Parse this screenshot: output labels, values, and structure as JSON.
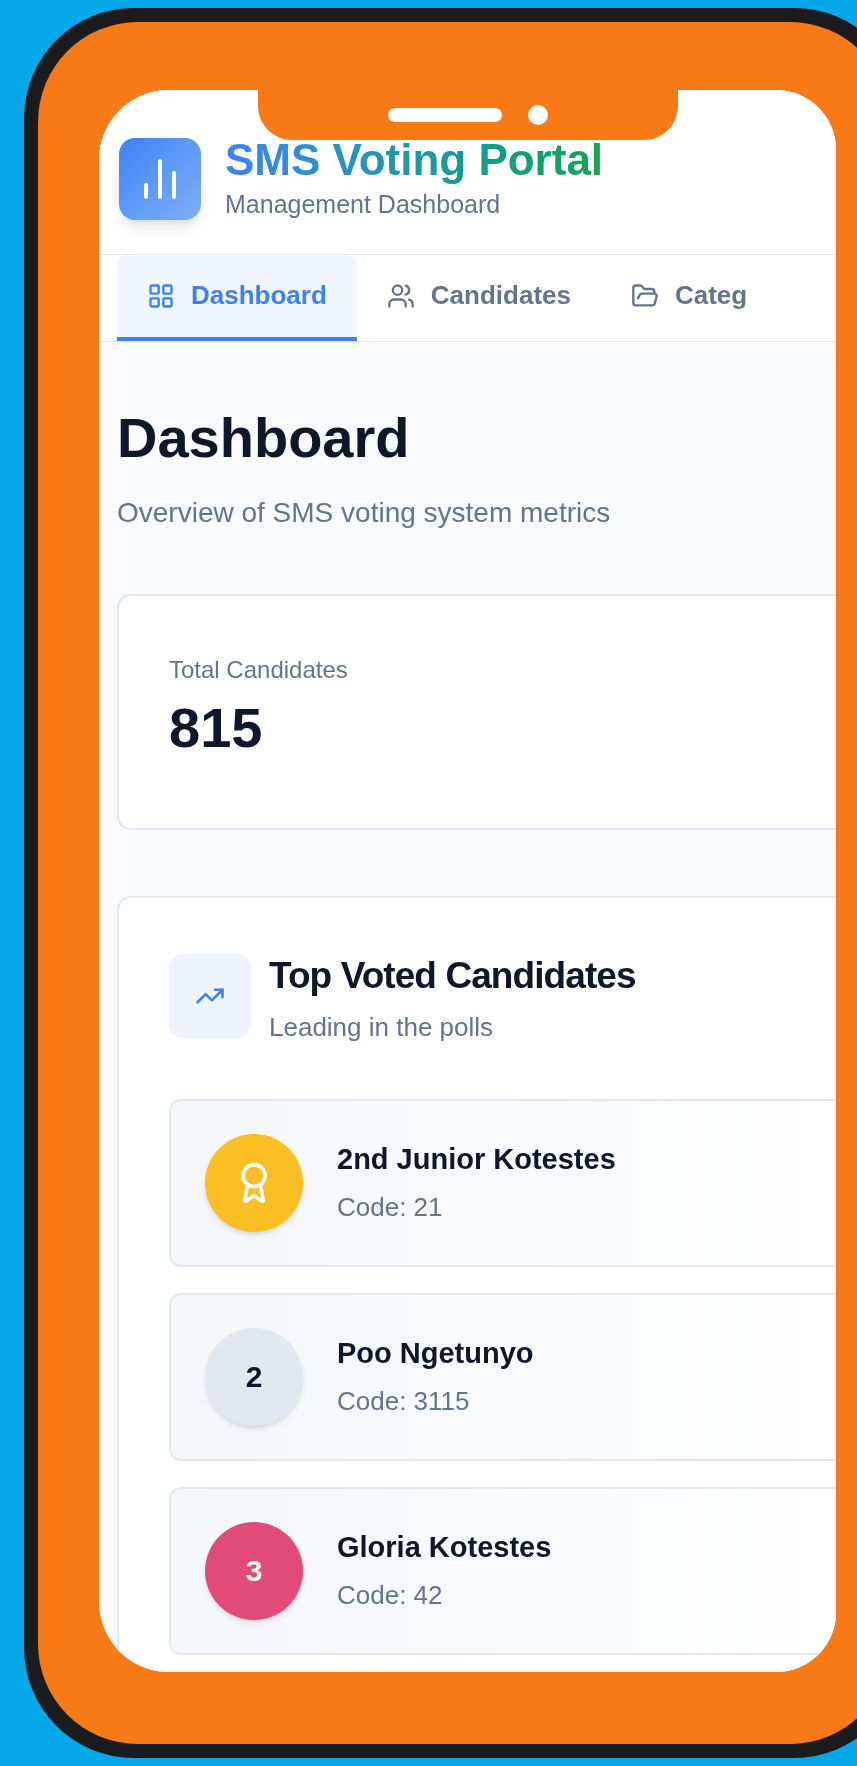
{
  "header": {
    "title": "SMS Voting Portal",
    "subtitle": "Management Dashboard"
  },
  "tabs": [
    {
      "label": "Dashboard",
      "kind": "grid",
      "selected": true
    },
    {
      "label": "Candidates",
      "kind": "users",
      "selected": false
    },
    {
      "label": "Categ",
      "kind": "folder",
      "selected": false
    }
  ],
  "page": {
    "title": "Dashboard",
    "subtitle": "Overview of SMS voting system metrics"
  },
  "stat": {
    "label": "Total Candidates",
    "value": "815"
  },
  "top_voted": {
    "title": "Top Voted Candidates",
    "subtitle": "Leading in the polls",
    "candidates": [
      {
        "kind": "award",
        "name": "2nd Junior Kotestes",
        "code": "Code: 21",
        "color": "#fbbf24"
      },
      {
        "kind": "number",
        "rank": "2",
        "name": "Poo Ngetunyo",
        "code": "Code: 3115",
        "color": "#e2e8f0"
      },
      {
        "kind": "number",
        "rank": "3",
        "name": "Gloria Kotestes",
        "code": "Code: 42",
        "color": "#e24a7a"
      }
    ]
  }
}
